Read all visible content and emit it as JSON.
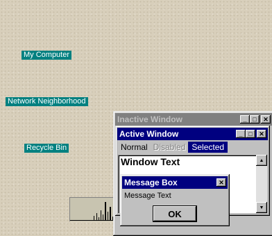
{
  "desktop": {
    "icons": [
      {
        "label": "My Computer"
      },
      {
        "label": "Network Neighborhood"
      },
      {
        "label": "Recycle Bin"
      }
    ]
  },
  "inactive_window": {
    "title": "Inactive Window",
    "buttons": {
      "minimize": "_",
      "maximize": "□",
      "close": "✕"
    }
  },
  "active_window": {
    "title": "Active Window",
    "menu": [
      "Normal",
      "Disabled",
      "Selected"
    ],
    "body_text": "Window Text",
    "buttons": {
      "minimize": "_",
      "maximize": "□",
      "close": "✕"
    }
  },
  "message_box": {
    "title": "Message Box",
    "text": "Message Text",
    "ok_label": "OK",
    "close": "✕"
  },
  "scrollbar": {
    "up": "▲",
    "down": "▼"
  },
  "colors": {
    "desktop": "#d8cfbb",
    "label_bg": "#008080",
    "active_title": "#000080",
    "inactive_title": "#808080",
    "selected_bg": "#000080"
  }
}
